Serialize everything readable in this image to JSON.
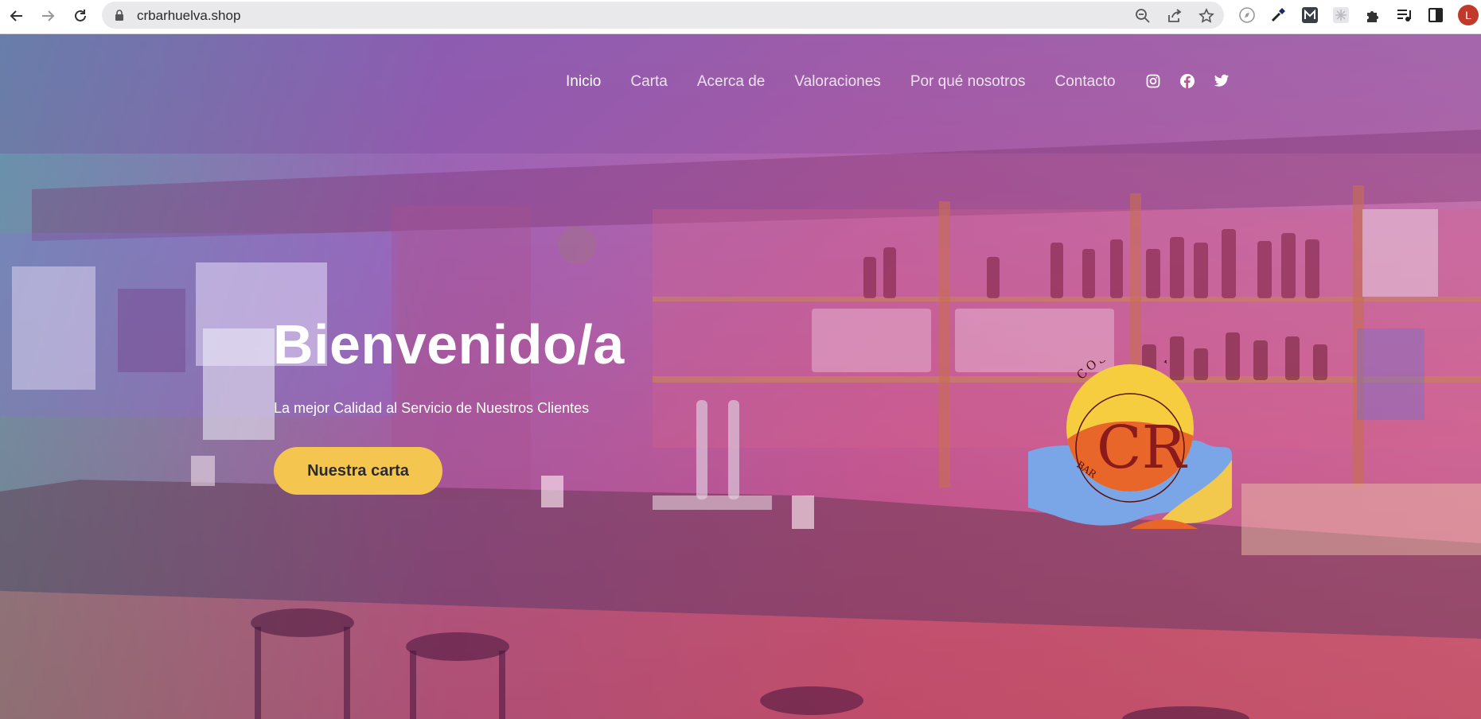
{
  "browser": {
    "url": "crbarhuelva.shop",
    "profile_initial": "L",
    "icons": {
      "back": "arrow-left-icon",
      "forward": "arrow-right-icon",
      "reload": "reload-icon",
      "lock": "lock-icon",
      "zoom": "zoom-out-icon",
      "share": "share-icon",
      "bookmark": "star-icon",
      "extensions": [
        "compass-extension-icon",
        "eyedropper-extension-icon",
        "m-extension-icon",
        "snowflake-extension-icon",
        "puzzle-extensions-icon",
        "media-control-icon",
        "side-panel-icon"
      ]
    }
  },
  "nav": {
    "items": [
      {
        "label": "Inicio",
        "active": true
      },
      {
        "label": "Carta",
        "active": false
      },
      {
        "label": "Acerca de",
        "active": false
      },
      {
        "label": "Valoraciones",
        "active": false
      },
      {
        "label": "Por qué nosotros",
        "active": false
      },
      {
        "label": "Contacto",
        "active": false
      }
    ],
    "social": [
      "instagram-icon",
      "facebook-icon",
      "twitter-icon"
    ]
  },
  "hero": {
    "title": "Bienvenido/a",
    "subtitle": "La mejor Calidad al Servicio de Nuestros Clientes",
    "cta_label": "Nuestra carta"
  },
  "logo": {
    "monogram": "CR",
    "arc_text": "COSTARICA",
    "bottom_text": "BAR"
  },
  "colors": {
    "accent_yellow": "#f5c64f",
    "logo_orange": "#e8662a",
    "logo_blue": "#7aa6e8",
    "logo_dark_red": "#8b1a1a",
    "profile_red": "#c0392b"
  }
}
